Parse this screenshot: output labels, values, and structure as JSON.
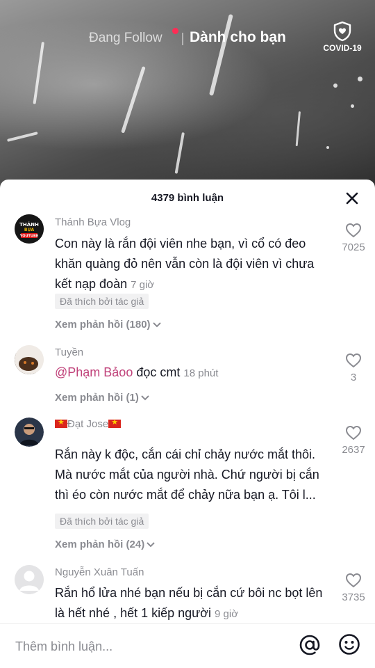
{
  "top_nav": {
    "following": "Đang Follow",
    "for_you": "Dành cho bạn",
    "covid": "COVID-19"
  },
  "comments_sheet": {
    "title": "4379 bình luận",
    "comments": [
      {
        "author": "Thánh Bựa Vlog",
        "avatar_text": "THÁNH BỰA YOUTUBE",
        "text": "Con này là rắn đội viên nhe bạn, vì cổ có đeo khăn quàng đỏ nên vẫn còn là đội viên vì chưa kết nạp đoàn",
        "time": "7 giờ",
        "badge": "Đã thích bởi tác giả",
        "replies": "Xem phản hồi (180)",
        "likes": "7025"
      },
      {
        "author": "Tuyền",
        "mention": "@Phạm Bảoo",
        "text": " đọc cmt",
        "time": "18 phút",
        "replies": "Xem phản hồi (1)",
        "likes": "3"
      },
      {
        "author": "Đạt Jose",
        "text": "Rắn này k độc, cắn cái chỉ chảy nước mắt thôi. Mà nước mắt của người nhà. Chứ người bị cắn thì éo còn nước mắt để chảy nữa bạn ạ. Tôi l...",
        "badge": "Đã thích bởi tác giả",
        "replies": "Xem phản hồi (24)",
        "likes": "2637"
      },
      {
        "author": "Nguyễn Xuân Tuấn",
        "text": "Rắn hổ lửa nhé bạn nếu bị cắn cứ bôi nc bọt lên là hết nhé , hết 1 kiếp người",
        "time": "9 giờ",
        "likes": "3735"
      }
    ]
  },
  "input": {
    "placeholder": "Thêm bình luận..."
  },
  "icons": {
    "close": "close-icon",
    "heart": "heart-outline-icon",
    "at": "at-sign-icon",
    "emoji": "smiley-icon",
    "shield": "shield-heart-icon"
  },
  "colors": {
    "accent": "#fe2c55",
    "mention": "#c0427a",
    "muted": "#8a8b91",
    "text": "#161823"
  }
}
